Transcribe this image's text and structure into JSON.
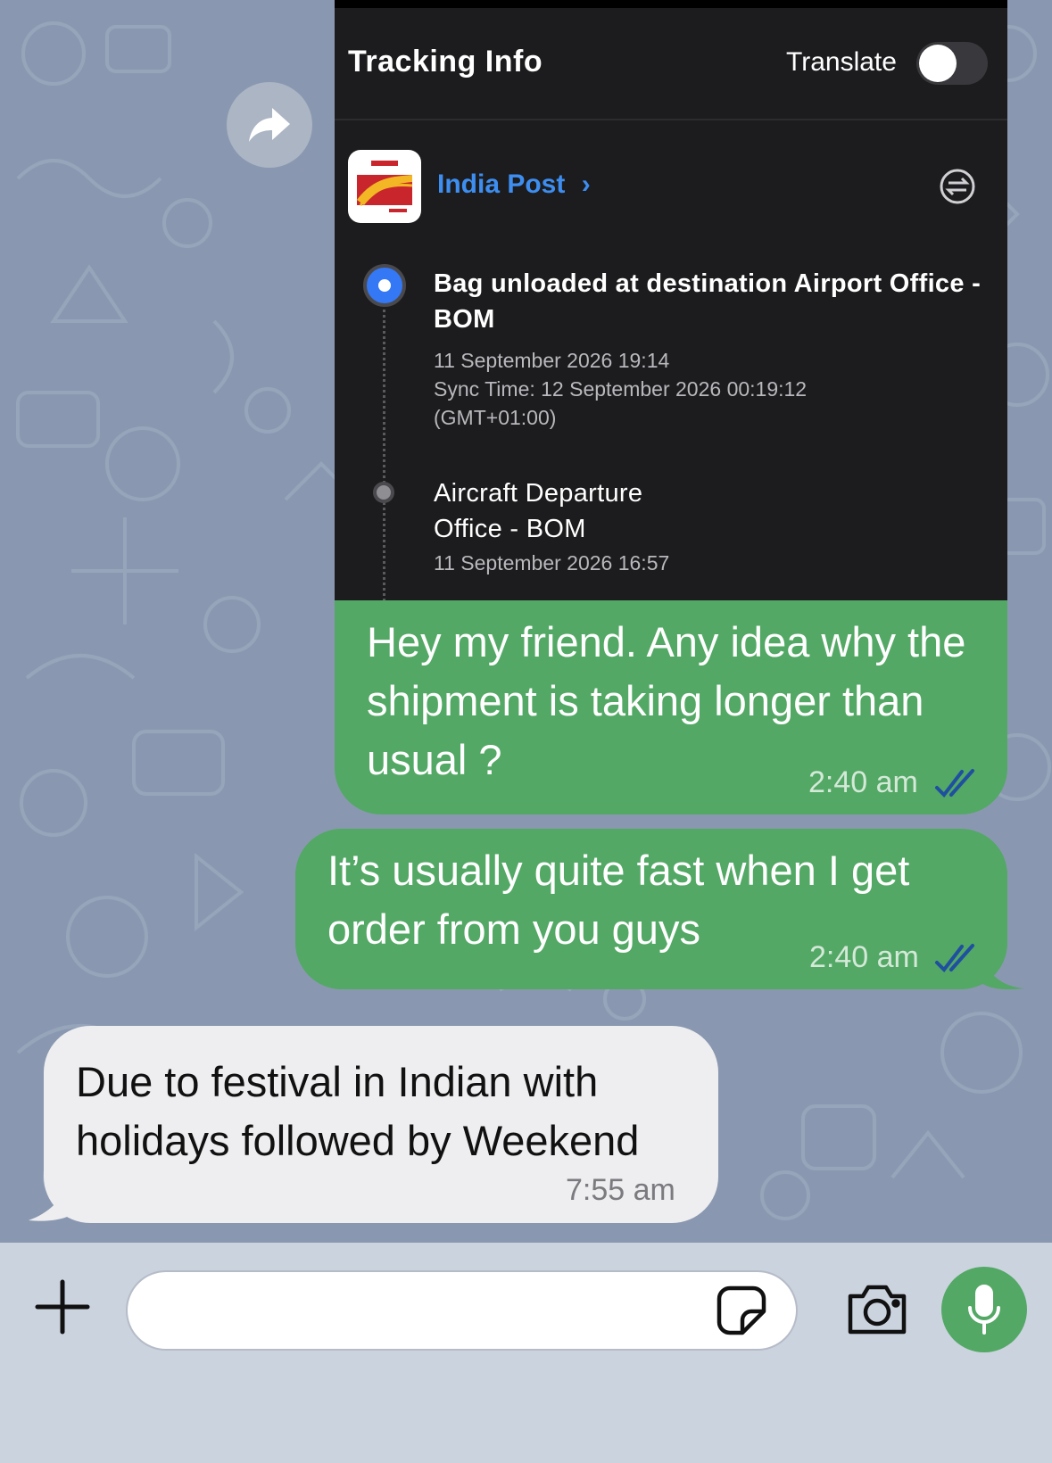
{
  "tracking": {
    "title": "Tracking Info",
    "translate_label": "Translate",
    "translate_on": false,
    "carrier_name": "India Post",
    "carrier_chevron": "›",
    "events": [
      {
        "title": "Bag unloaded at destination Airport Office - BOM",
        "time": "11 September 2026 19:14",
        "sync": "Sync Time: 12 September 2026 00:19:12 (GMT+01:00)"
      },
      {
        "title_line1": "Aircraft Departure",
        "title_line2": "Office - BOM",
        "time": "11 September 2026 16:57"
      }
    ]
  },
  "messages": [
    {
      "direction": "outgoing",
      "text": "Hey my friend. Any idea why the shipment is taking longer than usual ?",
      "time": "2:40 am",
      "status": "read"
    },
    {
      "direction": "outgoing",
      "text": "It’s usually quite fast when I get order from you guys",
      "time": "2:40 am",
      "status": "read"
    },
    {
      "direction": "incoming",
      "text": "Due to festival in Indian with holidays followed by Weekend",
      "time": "7:55 am"
    }
  ],
  "composer": {
    "value": "",
    "placeholder": ""
  },
  "icons": {
    "forward": "forward-arrow-icon",
    "swap": "swap-arrows-icon",
    "plus": "plus-icon",
    "sticker": "sticker-icon",
    "camera": "camera-icon",
    "mic": "microphone-icon",
    "ticks": "double-check-icon"
  },
  "colors": {
    "outgoing_bubble": "#53a865",
    "incoming_bubble": "#eeeef0",
    "chat_background": "#8998b0",
    "link_blue": "#3d8ef0",
    "read_ticks": "#1f4fa0"
  }
}
